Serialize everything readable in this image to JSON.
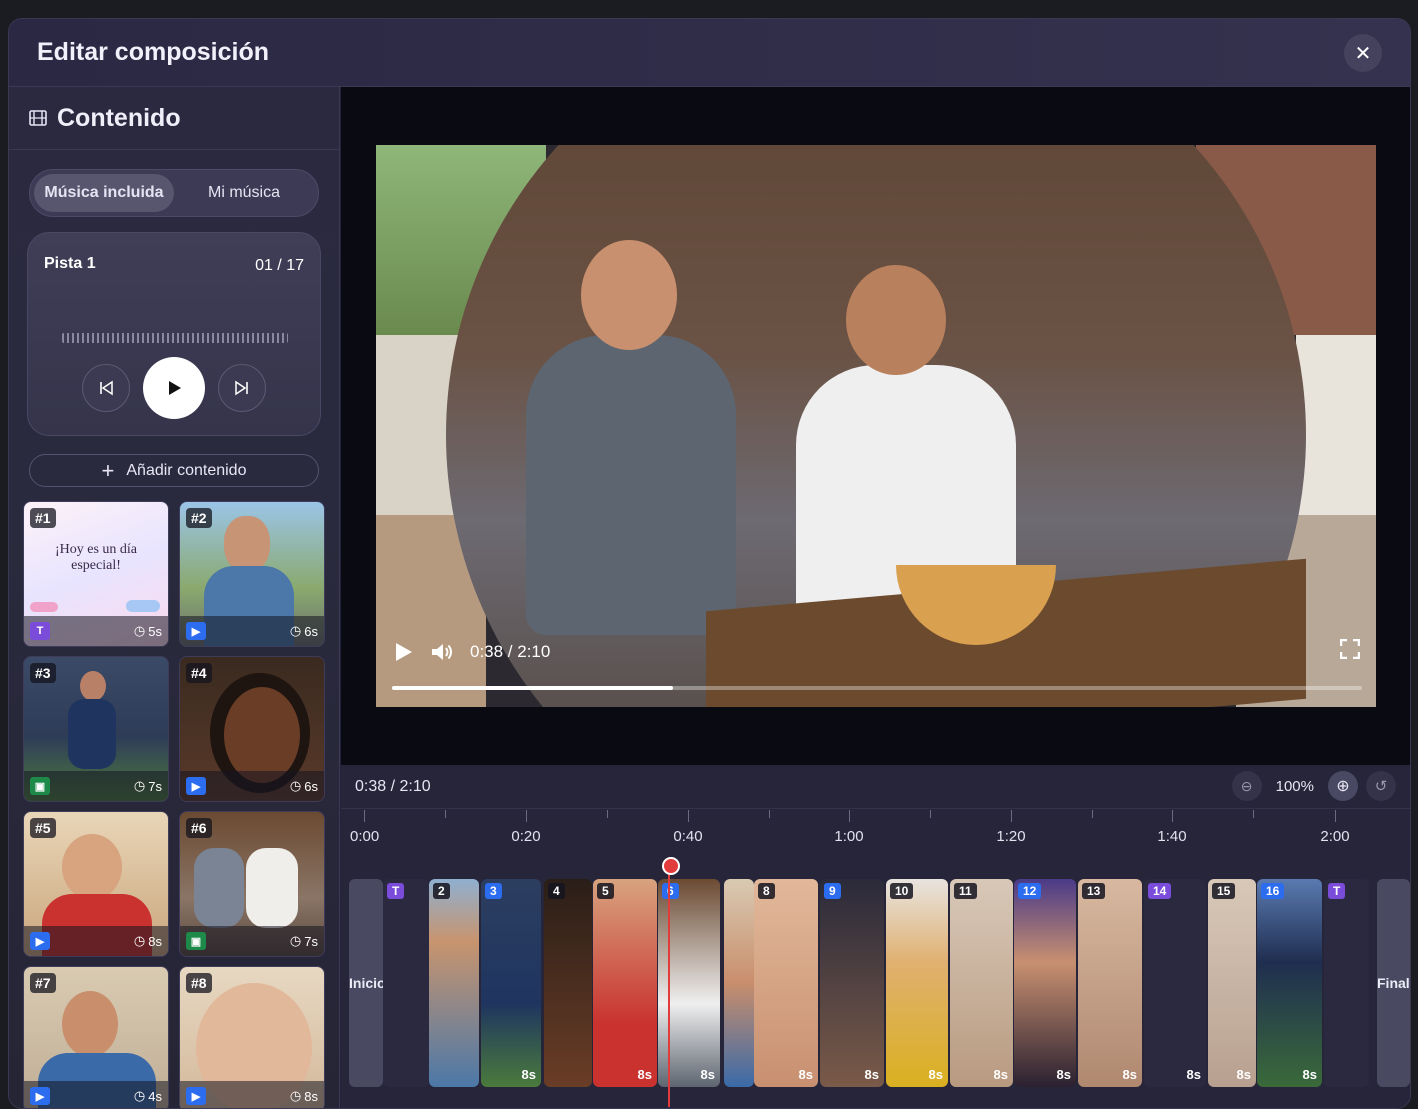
{
  "modal": {
    "title": "Editar composición",
    "close_icon": "close-icon"
  },
  "sidebar": {
    "title": "Contenido",
    "tabs": [
      "Música incluida",
      "Mi música"
    ],
    "active_tab": "Música incluida",
    "player": {
      "track_label": "Pista 1",
      "counter": "01 / 17"
    },
    "add_label": "Añadir contenido",
    "items": [
      {
        "tag": "#1",
        "badge": "T",
        "type": "text",
        "duration": "5s",
        "text": "¡Hoy es un día especial!"
      },
      {
        "tag": "#2",
        "badge": "video",
        "type": "video",
        "duration": "6s"
      },
      {
        "tag": "#3",
        "badge": "image",
        "type": "image",
        "duration": "7s"
      },
      {
        "tag": "#4",
        "badge": "video",
        "type": "video",
        "duration": "6s"
      },
      {
        "tag": "#5",
        "badge": "video",
        "type": "video",
        "duration": "8s"
      },
      {
        "tag": "#6",
        "badge": "image",
        "type": "image",
        "duration": "7s"
      },
      {
        "tag": "#7",
        "badge": "video",
        "type": "video",
        "duration": "4s"
      },
      {
        "tag": "#8",
        "badge": "video",
        "type": "video",
        "duration": "8s"
      }
    ]
  },
  "preview": {
    "time": "0:38 / 2:10",
    "progress": 0.29
  },
  "timeline": {
    "time": "0:38 / 2:10",
    "zoom": "100%",
    "ticks": [
      "0:00",
      "0:20",
      "0:40",
      "1:00",
      "1:20",
      "1:40",
      "2:00"
    ],
    "start_label": "Inicio",
    "end_label": "Final",
    "clips": [
      {
        "n": "T",
        "kind": "purple",
        "d": ""
      },
      {
        "n": "2",
        "kind": "plain",
        "d": ""
      },
      {
        "n": "3",
        "kind": "blue",
        "d": "8s"
      },
      {
        "n": "4",
        "kind": "plain",
        "d": ""
      },
      {
        "n": "5",
        "kind": "plain",
        "d": "8s"
      },
      {
        "n": "6",
        "kind": "blue",
        "d": "8s"
      },
      {
        "n": "",
        "kind": "plain",
        "d": ""
      },
      {
        "n": "8",
        "kind": "plain",
        "d": "8s"
      },
      {
        "n": "9",
        "kind": "blue",
        "d": "8s"
      },
      {
        "n": "10",
        "kind": "plain",
        "d": "8s"
      },
      {
        "n": "11",
        "kind": "plain",
        "d": "8s"
      },
      {
        "n": "12",
        "kind": "blue",
        "d": "8s"
      },
      {
        "n": "13",
        "kind": "plain",
        "d": "8s"
      },
      {
        "n": "14",
        "kind": "purple",
        "d": "8s"
      },
      {
        "n": "15",
        "kind": "plain",
        "d": "8s"
      },
      {
        "n": "16",
        "kind": "blue",
        "d": "8s"
      },
      {
        "n": "T",
        "kind": "purple",
        "d": ""
      }
    ]
  },
  "colors": {
    "accent_red": "#e23b3b",
    "clip_blue": "#2c6df0",
    "clip_purple": "#7b4bd9"
  }
}
